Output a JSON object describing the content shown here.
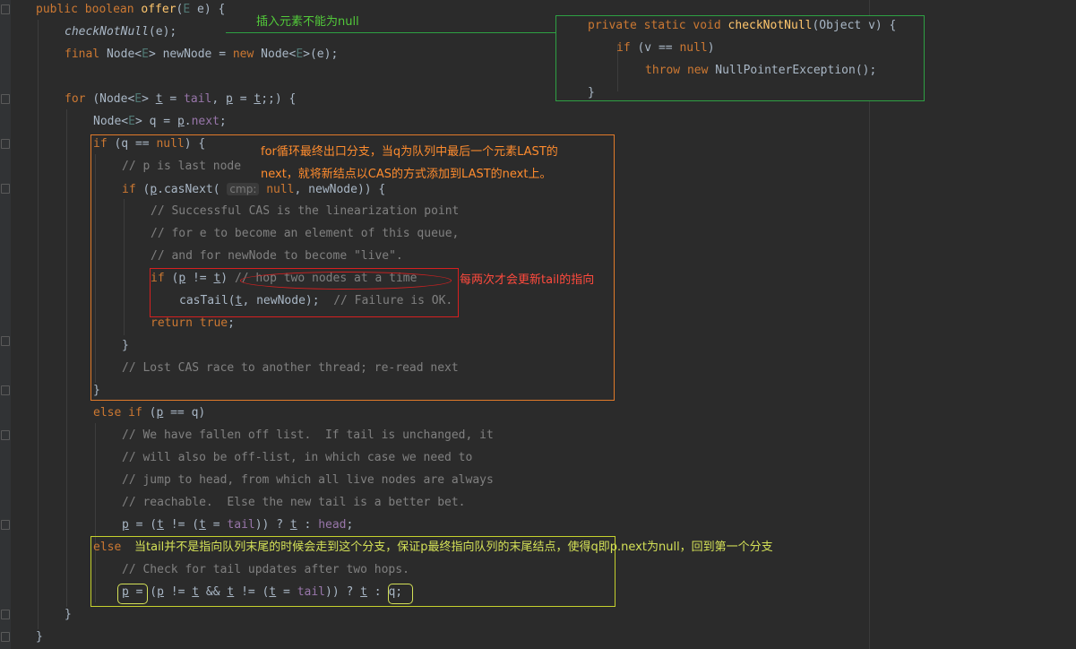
{
  "code": {
    "offer_sig": "public boolean offer(E e) {",
    "check_call": "checkNotNull(e);",
    "new_node": "final Node<E> newNode = new Node<E>(e);",
    "for_head": "for (Node<E> t = tail, p = t;;) {",
    "q_decl": "Node<E> q = p.next;",
    "if_q_null": "if (q == null) {",
    "c_last_node": "// p is last node",
    "if_cas_pre": "if (p.casNext(",
    "param_hint": "cmp:",
    "if_cas_post": "null, newNode)) {",
    "c_cas1": "// Successful CAS is the linearization point",
    "c_cas2": "// for e to become an element of this queue,",
    "c_cas3": "// and for newNode to become \"live\".",
    "if_p_ne_t": "if (p != t)",
    "c_hop": "// hop two nodes at a time",
    "cas_tail": "casTail(t, newNode);",
    "c_failure": "// Failure is OK.",
    "ret_true": "return true;",
    "close_brace": "}",
    "c_lost": "// Lost CAS race to another thread; re-read next",
    "elseif_pq": "else if (p == q)",
    "c_fall1": "// We have fallen off list.  If tail is unchanged, it",
    "c_fall2": "// will also be off-list, in which case we need to",
    "c_fall3": "// jump to head, from which all live nodes are always",
    "c_fall4": "// reachable.  Else the new tail is a better bet.",
    "p_assign_head": "p = (t != (t = tail)) ? t : head;",
    "else_kw": "else",
    "c_check_tail": "// Check for tail updates after two hops.",
    "p_assign_q_a": "p =",
    "p_assign_q_b": "(p != t && t != (t = tail)) ? t :",
    "p_assign_q_c": "q;",
    "popup_sig": "private static void checkNotNull(Object v) {",
    "popup_if": "if (v == null)",
    "popup_throw": "throw new NullPointerException();",
    "popup_close": "}"
  },
  "annotations": {
    "not_null": "插入元素不能为null",
    "exit_branch_1": "for循环最终出口分支，当q为队列中最后一个元素LAST的",
    "exit_branch_2": "next，就将新结点以CAS的方式添加到LAST的next上。",
    "tail_update": "每两次才会更新tail的指向",
    "else_branch": "当tail并不是指向队列末尾的时候会走到这个分支，保证p最终指向队列的末尾结点，使得q即p.next为null，回到第一个分支"
  },
  "colors": {
    "background": "#2b2b2b",
    "green_box": "#2ea043",
    "orange_box": "#e07a2a",
    "red_box": "#d62020",
    "yellow_box": "#c5d12d",
    "keyword": "#cc7832",
    "method": "#ffc66d",
    "comment": "#808080",
    "field": "#9876aa",
    "plain": "#a9b7c6"
  }
}
